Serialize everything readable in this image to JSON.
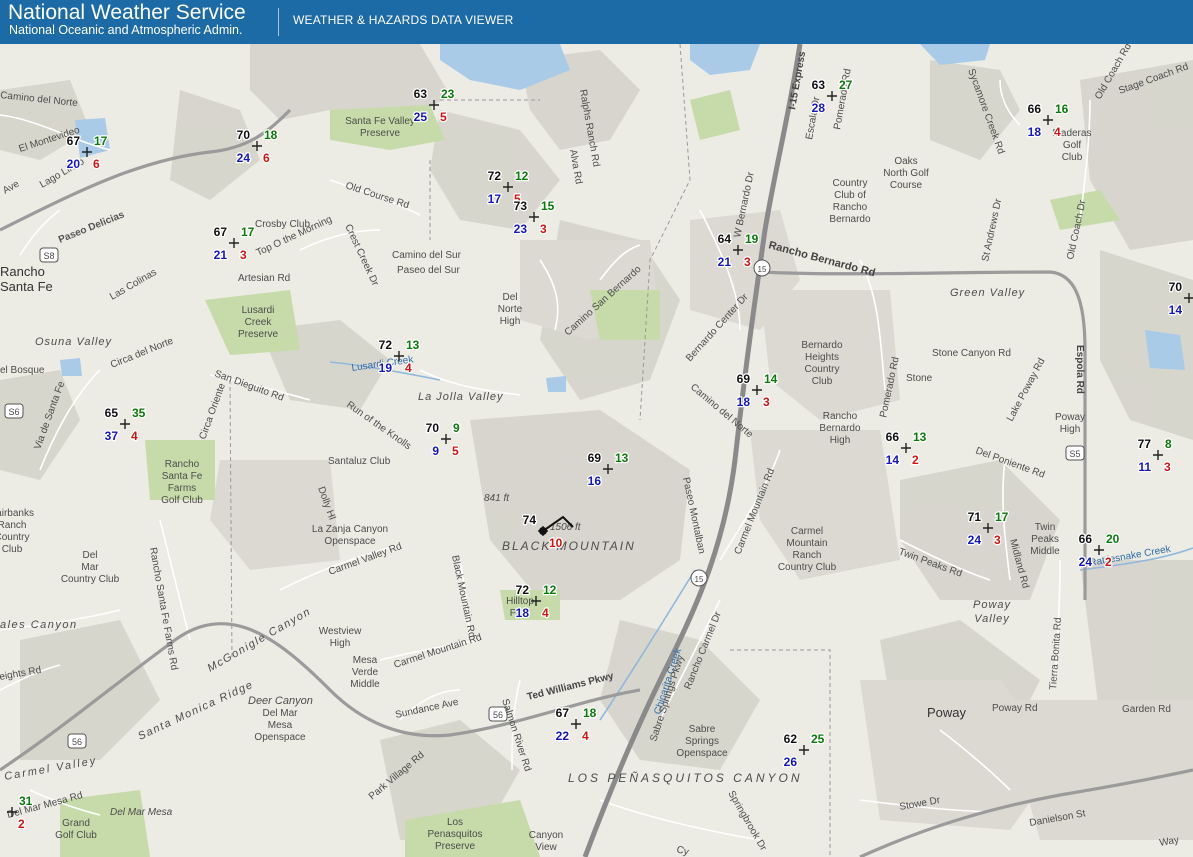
{
  "header": {
    "agency": "National Weather Service",
    "subtitle": "National Oceanic and Atmospheric Admin.",
    "viewer": "WEATHER & HAZARDS DATA VIEWER"
  },
  "colors": {
    "header_bg": "#1c6aa6",
    "temperature": "#111111",
    "dewpoint": "#0a7a0a",
    "wind_speed": "#1515c8",
    "wind_gust": "#d51313"
  },
  "stations": [
    {
      "temp": "63",
      "dew": "23",
      "wind": "25",
      "gust": "5"
    },
    {
      "temp": "67",
      "dew": "17",
      "wind": "20",
      "gust": "6"
    },
    {
      "temp": "70",
      "dew": "18",
      "wind": "24",
      "gust": "6"
    },
    {
      "temp": "63",
      "dew": "27",
      "wind": "28",
      "gust": ""
    },
    {
      "temp": "66",
      "dew": "16",
      "wind": "18",
      "gust": "4"
    },
    {
      "temp": "72",
      "dew": "12",
      "wind": "17",
      "gust": "5"
    },
    {
      "temp": "73",
      "dew": "15",
      "wind": "23",
      "gust": "3"
    },
    {
      "temp": "67",
      "dew": "17",
      "wind": "21",
      "gust": "3"
    },
    {
      "temp": "64",
      "dew": "19",
      "wind": "21",
      "gust": "3"
    },
    {
      "temp": "70",
      "dew": "",
      "wind": "14",
      "gust": ""
    },
    {
      "temp": "72",
      "dew": "13",
      "wind": "19",
      "gust": "4"
    },
    {
      "temp": "69",
      "dew": "14",
      "wind": "18",
      "gust": "3"
    },
    {
      "temp": "65",
      "dew": "35",
      "wind": "37",
      "gust": "4"
    },
    {
      "temp": "70",
      "dew": "9",
      "wind": "9",
      "gust": "5"
    },
    {
      "temp": "66",
      "dew": "13",
      "wind": "14",
      "gust": "2"
    },
    {
      "temp": "77",
      "dew": "8",
      "wind": "11",
      "gust": "3"
    },
    {
      "temp": "69",
      "dew": "13",
      "wind": "16",
      "gust": ""
    },
    {
      "temp": "74",
      "dew": "",
      "wind": "",
      "gust": "10"
    },
    {
      "temp": "71",
      "dew": "17",
      "wind": "24",
      "gust": "3"
    },
    {
      "temp": "66",
      "dew": "20",
      "wind": "24",
      "gust": "2"
    },
    {
      "temp": "72",
      "dew": "12",
      "wind": "18",
      "gust": "4"
    },
    {
      "temp": "67",
      "dew": "18",
      "wind": "22",
      "gust": "4"
    },
    {
      "temp": "62",
      "dew": "25",
      "wind": "26",
      "gust": ""
    },
    {
      "temp": "",
      "dew": "31",
      "wind": "",
      "gust": "2"
    }
  ],
  "labels": {
    "rancho_santa_fe": [
      "Rancho",
      "Santa Fe"
    ],
    "camino_del_norte_w": "Camino del Norte",
    "el_montevideo": "El Montevideo",
    "lago_lindo": "Lago Lindo",
    "ave_w": "Ave",
    "paseo_delicias": "Paseo Delicias",
    "old_course_rd": "Old Course Rd",
    "crosby_club": "Crosby Club",
    "top_o_the_morning": "Top O the Morning",
    "artesian_rd": "Artesian Rd",
    "las_colinas": "Las Colinas",
    "lusardi_creek_preserve": [
      "Lusardi",
      "Creek",
      "Preserve"
    ],
    "osuna_valley": "Osuna Valley",
    "el_bosque": "el Bosque",
    "circa_del_norte": "Circa del Norte",
    "san_dieguito_rd": "San Dieguito Rd",
    "via_de_santa_fe": "Via de Santa Fe",
    "circa_oriente": "Circa Oriente",
    "rancho_santa_fe_farms": [
      "Rancho",
      "Santa Fe",
      "Farms",
      "Golf Club"
    ],
    "fairbanks_ranch": [
      "Fairbanks",
      "Ranch",
      "Country",
      "Club"
    ],
    "del_mar_country_club": [
      "Del",
      "Mar",
      "Country Club"
    ],
    "rancho_santa_fe_farms_rd": "Rancho Santa Fe Farms Rd",
    "los_canyon_w": "ales Canyon",
    "heights_rd": "eights Rd",
    "carmel_valley_w": "Carmel Valley",
    "del_mar_mesa_rd": "Del Mar Mesa Rd",
    "del_mar_mesa": "Del Mar Mesa",
    "grand_golf_club": [
      "Grand",
      "Golf Club"
    ],
    "santa_fe_valley_preserve": [
      "Santa Fe Valley",
      "Preserve"
    ],
    "ralphs_ranch_rd": "Ralphs Ranch Rd",
    "alva_rd": "Alva Rd",
    "crest_creek_dr": "Crest Creek Dr",
    "camino_del_sur": "Camino del Sur",
    "paseo_del_sur": "Paseo del Sur",
    "del_norte_high": [
      "Del",
      "Norte",
      "High"
    ],
    "camino_san_bernardo": "Camino San Bernardo",
    "lusardi_creek_river": "Lusardi Creek",
    "la_jolla_valley": "La Jolla Valley",
    "run_of_the_knolls": "Run of the Knolls",
    "santaluz_club": "Santaluz Club",
    "dolly_hl": "Dolly Hl",
    "la_zanja_canyon": [
      "La Zanja Canyon",
      "Openspace"
    ],
    "carmel_valley_rd": "Carmel Valley Rd",
    "black_mountain_rd": "Black Mountain Rd",
    "elev_841": "841 ft",
    "elev_1506": "1506 ft",
    "black_mountain": "BLACK MOUNTAIN",
    "paseo_montalban": "Paseo Montalban",
    "hilltop_park": [
      "Hilltop",
      "Park"
    ],
    "carmel_mountain_rd": "Carmel Mountain Rd",
    "westview_high": [
      "Westview",
      "High"
    ],
    "mesa_verde_middle": [
      "Mesa",
      "Verde",
      "Middle"
    ],
    "mcgonigle_canyon": "McGonigle Canyon",
    "santa_monica_ridge": "Santa Monica Ridge",
    "deer_canyon": "Deer Canyon",
    "del_mar_mesa_openspace": [
      "Del Mar",
      "Mesa",
      "Openspace"
    ],
    "sundance_ave": "Sundance Ave",
    "salmon_river_rd": "Salmon River Rd",
    "ted_williams_pkwy": "Ted Williams Pkwy",
    "park_village_rd": "Park Village Rd",
    "los_penasquitos_preserve": [
      "Los",
      "Penasquitos",
      "Preserve"
    ],
    "canyon_view": [
      "Canyon",
      "View"
    ],
    "los_penasquitos_canyon": "LOS PEÑASQUITOS CANYON",
    "chicarita_creek": "Chicarita Creek",
    "sabre_springs_pkwy": "Sabre Springs Pkwy",
    "rancho_carmel_dr": "Rancho Carmel Dr",
    "sabre_springs_openspace": [
      "Sabre",
      "Springs",
      "Openspace"
    ],
    "springbrook_dr": "Springbrook Dr",
    "carmel_mountain_ranch": [
      "Carmel",
      "Mountain",
      "Ranch",
      "Country Club"
    ],
    "carmel_mountain_rd_e": "Carmel Mountain Rd",
    "i15_express": "I-15 Express",
    "escala_dr": "Escala Dr",
    "pomerado_rd_n": "Pomerado Rd",
    "w_bernardo_dr": "W Bernardo Dr",
    "rancho_bernardo_rd": "Rancho Bernardo Rd",
    "bernardo_center_dr": "Bernardo Center Dr",
    "camino_del_norte": "Camino del Norte",
    "bernardo_heights_cc": [
      "Bernardo",
      "Heights",
      "Country",
      "Club"
    ],
    "rancho_bernardo_high": [
      "Rancho",
      "Bernardo",
      "High"
    ],
    "oaks_north_golf": [
      "Oaks",
      "North Golf",
      "Course"
    ],
    "country_club_rb": [
      "Country",
      "Club of",
      "Rancho",
      "Bernardo"
    ],
    "sycamore_creek_rd": "Sycamore Creek Rd",
    "maderas_golf": [
      "Maderas",
      "Golf",
      "Club"
    ],
    "old_coach_rd": "Old Coach Rd",
    "old_coach_dr": "Old Coach Dr",
    "stage_coach_rd": "Stage Coach Rd",
    "st_andrews_dr": "St Andrews Dr",
    "green_valley": "Green Valley",
    "stone_canyon_rd": "Stone Canyon Rd",
    "stone": "Stone",
    "espola_rd": "Espola Rd",
    "lake_poway_rd": "Lake Poway Rd",
    "poway_high": [
      "Poway",
      "High"
    ],
    "pomerado_rd": "Pomerado Rd",
    "del_poniente_rd": "Del Poniente Rd",
    "twin_peaks_rd": "Twin Peaks Rd",
    "twin_peaks_middle": [
      "Twin",
      "Peaks",
      "Middle"
    ],
    "midland_rd": "Midland Rd",
    "tierra_bonita_rd": "Tierra Bonita Rd",
    "rattlesnake_creek": "Rattlesnake Creek",
    "poway_valley": [
      "Poway",
      "Valley"
    ],
    "poway": "Poway",
    "poway_rd": "Poway Rd",
    "garden_rd": "Garden Rd",
    "stowe_dr": "Stowe Dr",
    "danielson_st": "Danielson St",
    "way": "Way",
    "cypress": "Cy",
    "s8": "S8",
    "s6": "S6",
    "s5": "S5",
    "i15a": "15",
    "i15b": "15",
    "r56a": "56",
    "r56b": "56"
  }
}
